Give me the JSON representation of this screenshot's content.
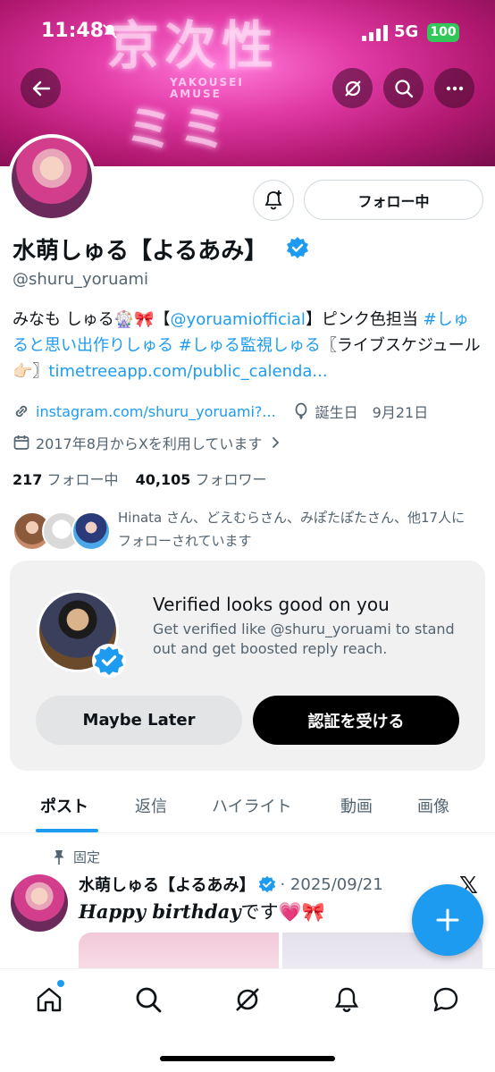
{
  "status": {
    "time": "11:48",
    "network": "5G",
    "battery": "100"
  },
  "banner": {
    "neon_top": "京次性",
    "neon_bottom": "ミミ",
    "neon_small": "YAKOUSEI\nAMUSE"
  },
  "profile": {
    "follow_label": "フォロー中",
    "name": "水萌しゅる【よるあみ】",
    "handle": "@shuru_yoruami",
    "bio_part1": "みなも しゅる🎡🎀【",
    "bio_mention": "@yoruamiofficial",
    "bio_part2": "】ピンク色担当 ",
    "bio_tag1": "#しゅると思い出作りしゅる",
    "bio_space": " ",
    "bio_tag2": "#しゅる監視しゅる",
    "bio_part3": "〖ライブスケジュール👉🏻〗",
    "bio_link": "timetreeapp.com/public_calenda...",
    "website": "instagram.com/shuru_yoruami?...",
    "birthday": "誕生日　9月21日",
    "joined": "2017年8月からXを利用しています",
    "following_count": "217",
    "following_label": "フォロー中",
    "followers_count": "40,105",
    "followers_label": "フォロワー",
    "followed_by": "Hinata さん、どえむらさん、みぽたぽたさん、他17人にフォローされています"
  },
  "verified_card": {
    "title": "Verified looks good on you",
    "text": "Get verified like @shuru_yoruami to stand out and get boosted reply reach.",
    "maybe_label": "Maybe Later",
    "verify_label": "認証を受ける"
  },
  "tabs": [
    "ポスト",
    "返信",
    "ハイライト",
    "動画",
    "画像"
  ],
  "tweet": {
    "pinned_label": "固定",
    "author": "水萌しゅる【よるあみ】",
    "date": "· 2025/09/21",
    "text_styled": "Happy birthday",
    "text_rest": "です💗🎀"
  },
  "colors": {
    "accent": "#1d9bf0",
    "banner": "#e23aa6",
    "text": "#0f1419",
    "muted": "#536471"
  }
}
